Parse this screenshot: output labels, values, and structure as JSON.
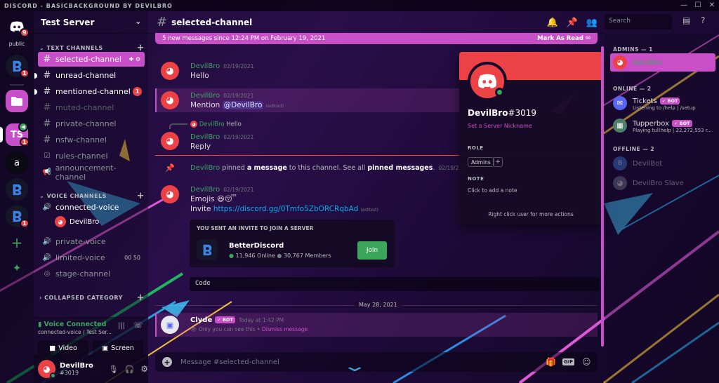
{
  "window": {
    "title": "DISCORD - BASICBACKGROUND BY DEVILBRO"
  },
  "guilds": {
    "home_badge": "9",
    "public_label": "public",
    "items": [
      {
        "label": "",
        "badge": "1"
      },
      {
        "label": "TS",
        "badge": "1"
      },
      {
        "label": "a",
        "badge": ""
      },
      {
        "label": "",
        "badge": ""
      },
      {
        "label": "",
        "badge": "1"
      }
    ]
  },
  "server": {
    "name": "Test Server",
    "categories": {
      "text": "TEXT CHANNELS",
      "voice": "VOICE CHANNELS",
      "collapsed": "COLLAPSED CATEGORY"
    },
    "text_channels": [
      {
        "name": "selected-channel",
        "state": "selected"
      },
      {
        "name": "unread-channel",
        "state": "unread"
      },
      {
        "name": "mentioned-channel",
        "state": "mention",
        "badge": "1"
      },
      {
        "name": "muted-channel",
        "state": "muted"
      },
      {
        "name": "private-channel",
        "state": "normal"
      },
      {
        "name": "nsfw-channel",
        "state": "normal"
      },
      {
        "name": "rules-channel",
        "state": "normal"
      },
      {
        "name": "announcement-channel",
        "state": "normal"
      }
    ],
    "voice_channels": [
      {
        "name": "connected-voice",
        "state": "connected",
        "users": [
          "DevilBro"
        ]
      },
      {
        "name": "private-voice",
        "state": "normal"
      },
      {
        "name": "limited-voice",
        "state": "normal",
        "limit": "00 50"
      },
      {
        "name": "stage-channel",
        "state": "normal"
      }
    ]
  },
  "voice_connection": {
    "status": "Voice Connected",
    "location": "connected-voice / Test Ser...",
    "video_label": "Video",
    "screen_label": "Screen"
  },
  "current_user": {
    "name": "DevilBro",
    "tag": "#3019"
  },
  "channel": {
    "name": "selected-channel"
  },
  "new_messages_bar": {
    "text": "5 new messages since 12:24 PM on February 19, 2021",
    "action": "Mark As Read"
  },
  "messages": [
    {
      "author": "DevilBro",
      "time": "02/19/2021",
      "text": "Hello"
    },
    {
      "author": "DevilBro",
      "time": "02/19/2021",
      "text": "Mention ",
      "mention": "@DevilBro",
      "edited": "(edited)"
    },
    {
      "reply_author": "DevilBro",
      "reply_text": "Hello",
      "author": "DevilBro",
      "time": "02/19/2021",
      "text": "Reply"
    },
    {
      "system": true,
      "author": "DevilBro",
      "pre": " pinned ",
      "bold1": "a message",
      "mid": " to this channel. See all ",
      "bold2": "pinned messages",
      "post": ".",
      "time": "02/19/2021"
    },
    {
      "author": "DevilBro",
      "time": "02/19/2021",
      "text": "Emojis 😆😴",
      "invite_pre": "Invite ",
      "link": "https://discord.gg/0Tmfo5ZbORCRqbAd",
      "edited": "(edited)"
    }
  ],
  "invite": {
    "header": "YOU SENT AN INVITE TO JOIN A SERVER",
    "server": "BetterDiscord",
    "online": "11,946 Online",
    "members": "30,767 Members",
    "join_label": "Join"
  },
  "code_block": "Code",
  "date_divider": "May 28, 2021",
  "clyde": {
    "author": "Clyde",
    "bot": "✓ BOT",
    "time": "Today at 1:42 PM",
    "note": "Only you can see this • ",
    "dismiss": "Dismiss message"
  },
  "composer": {
    "placeholder": "Message #selected-channel",
    "gif": "GIF"
  },
  "search": {
    "placeholder": "Search"
  },
  "popout": {
    "username": "DevilBro",
    "discriminator": "#3019",
    "nickname_hint": "Set a Server Nickname",
    "role_label": "ROLE",
    "role": "Admins",
    "note_label": "NOTE",
    "note_hint": "Click to add a note",
    "footer": "Right click user for more actions"
  },
  "members": {
    "admins_label": "ADMINS — 1",
    "online_label": "ONLINE — 2",
    "offline_label": "OFFLINE — 2",
    "admins": [
      {
        "name": "DevilBro"
      }
    ],
    "online": [
      {
        "name": "Tickets",
        "bot": "✓ BOT",
        "activity": "Listening to /help | /setup"
      },
      {
        "name": "Tupperbox",
        "bot": "✓ BOT",
        "activity": "Playing tul!help | 22,272,553 r..."
      }
    ],
    "offline": [
      {
        "name": "DevilBot"
      },
      {
        "name": "DevilBro Slave"
      }
    ]
  },
  "colors": {
    "accent": "#c94fc9",
    "danger": "#ed4245",
    "online": "#3ba55c"
  }
}
